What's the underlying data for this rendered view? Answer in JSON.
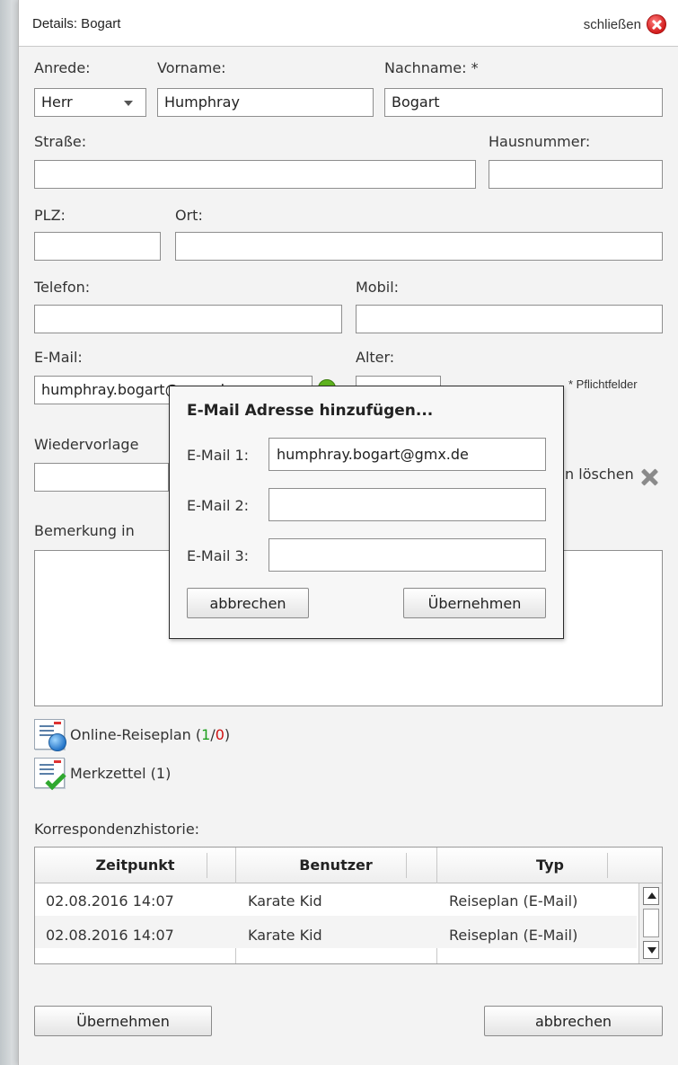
{
  "header": {
    "title": "Details: Bogart",
    "close_label": "schließen"
  },
  "form": {
    "anrede": {
      "label": "Anrede:",
      "value": "Herr"
    },
    "vorname": {
      "label": "Vorname:",
      "value": "Humphray"
    },
    "nachname": {
      "label": "Nachname: *",
      "value": "Bogart"
    },
    "strasse": {
      "label": "Straße:",
      "value": ""
    },
    "hausnummer": {
      "label": "Hausnummer:",
      "value": ""
    },
    "plz": {
      "label": "PLZ:",
      "value": ""
    },
    "ort": {
      "label": "Ort:",
      "value": ""
    },
    "telefon": {
      "label": "Telefon:",
      "value": ""
    },
    "mobil": {
      "label": "Mobil:",
      "value": ""
    },
    "email": {
      "label": "E-Mail:",
      "value": "humphray.bogart@gmx.de"
    },
    "alter": {
      "label": "Alter:",
      "value": ""
    },
    "pflicht_note": "* Pflichtfelder",
    "wiedervorlage": {
      "label": "Wiedervorlage",
      "value": ""
    },
    "termin_loeschen": "min löschen",
    "bemerkung": {
      "label": "Bemerkung in",
      "value": ""
    }
  },
  "links": {
    "reiseplan": {
      "label": "Online-Reiseplan (",
      "green": "1",
      "sep": "/",
      "red": "0",
      "end": ")"
    },
    "merkzettel": {
      "label": "Merkzettel (1)"
    }
  },
  "history": {
    "label": "Korrespondenzhistorie:",
    "columns": [
      "Zeitpunkt",
      "Benutzer",
      "Typ"
    ],
    "rows": [
      [
        "02.08.2016 14:07",
        "Karate Kid",
        "Reiseplan (E-Mail)"
      ],
      [
        "02.08.2016 14:07",
        "Karate Kid",
        "Reiseplan (E-Mail)"
      ]
    ]
  },
  "footer": {
    "save_label": "Übernehmen",
    "cancel_label": "abbrechen"
  },
  "modal": {
    "title": "E-Mail Adresse hinzufügen...",
    "email1": {
      "label": "E-Mail 1:",
      "value": "humphray.bogart@gmx.de"
    },
    "email2": {
      "label": "E-Mail 2:",
      "value": ""
    },
    "email3": {
      "label": "E-Mail 3:",
      "value": ""
    },
    "cancel_label": "abbrechen",
    "save_label": "Übernehmen"
  },
  "icons": {
    "close": "close-circle-icon",
    "help": "help-icon",
    "delete": "delete-x-icon",
    "reiseplan": "reiseplan-doc-globe-icon",
    "merkzettel": "checklist-icon"
  }
}
